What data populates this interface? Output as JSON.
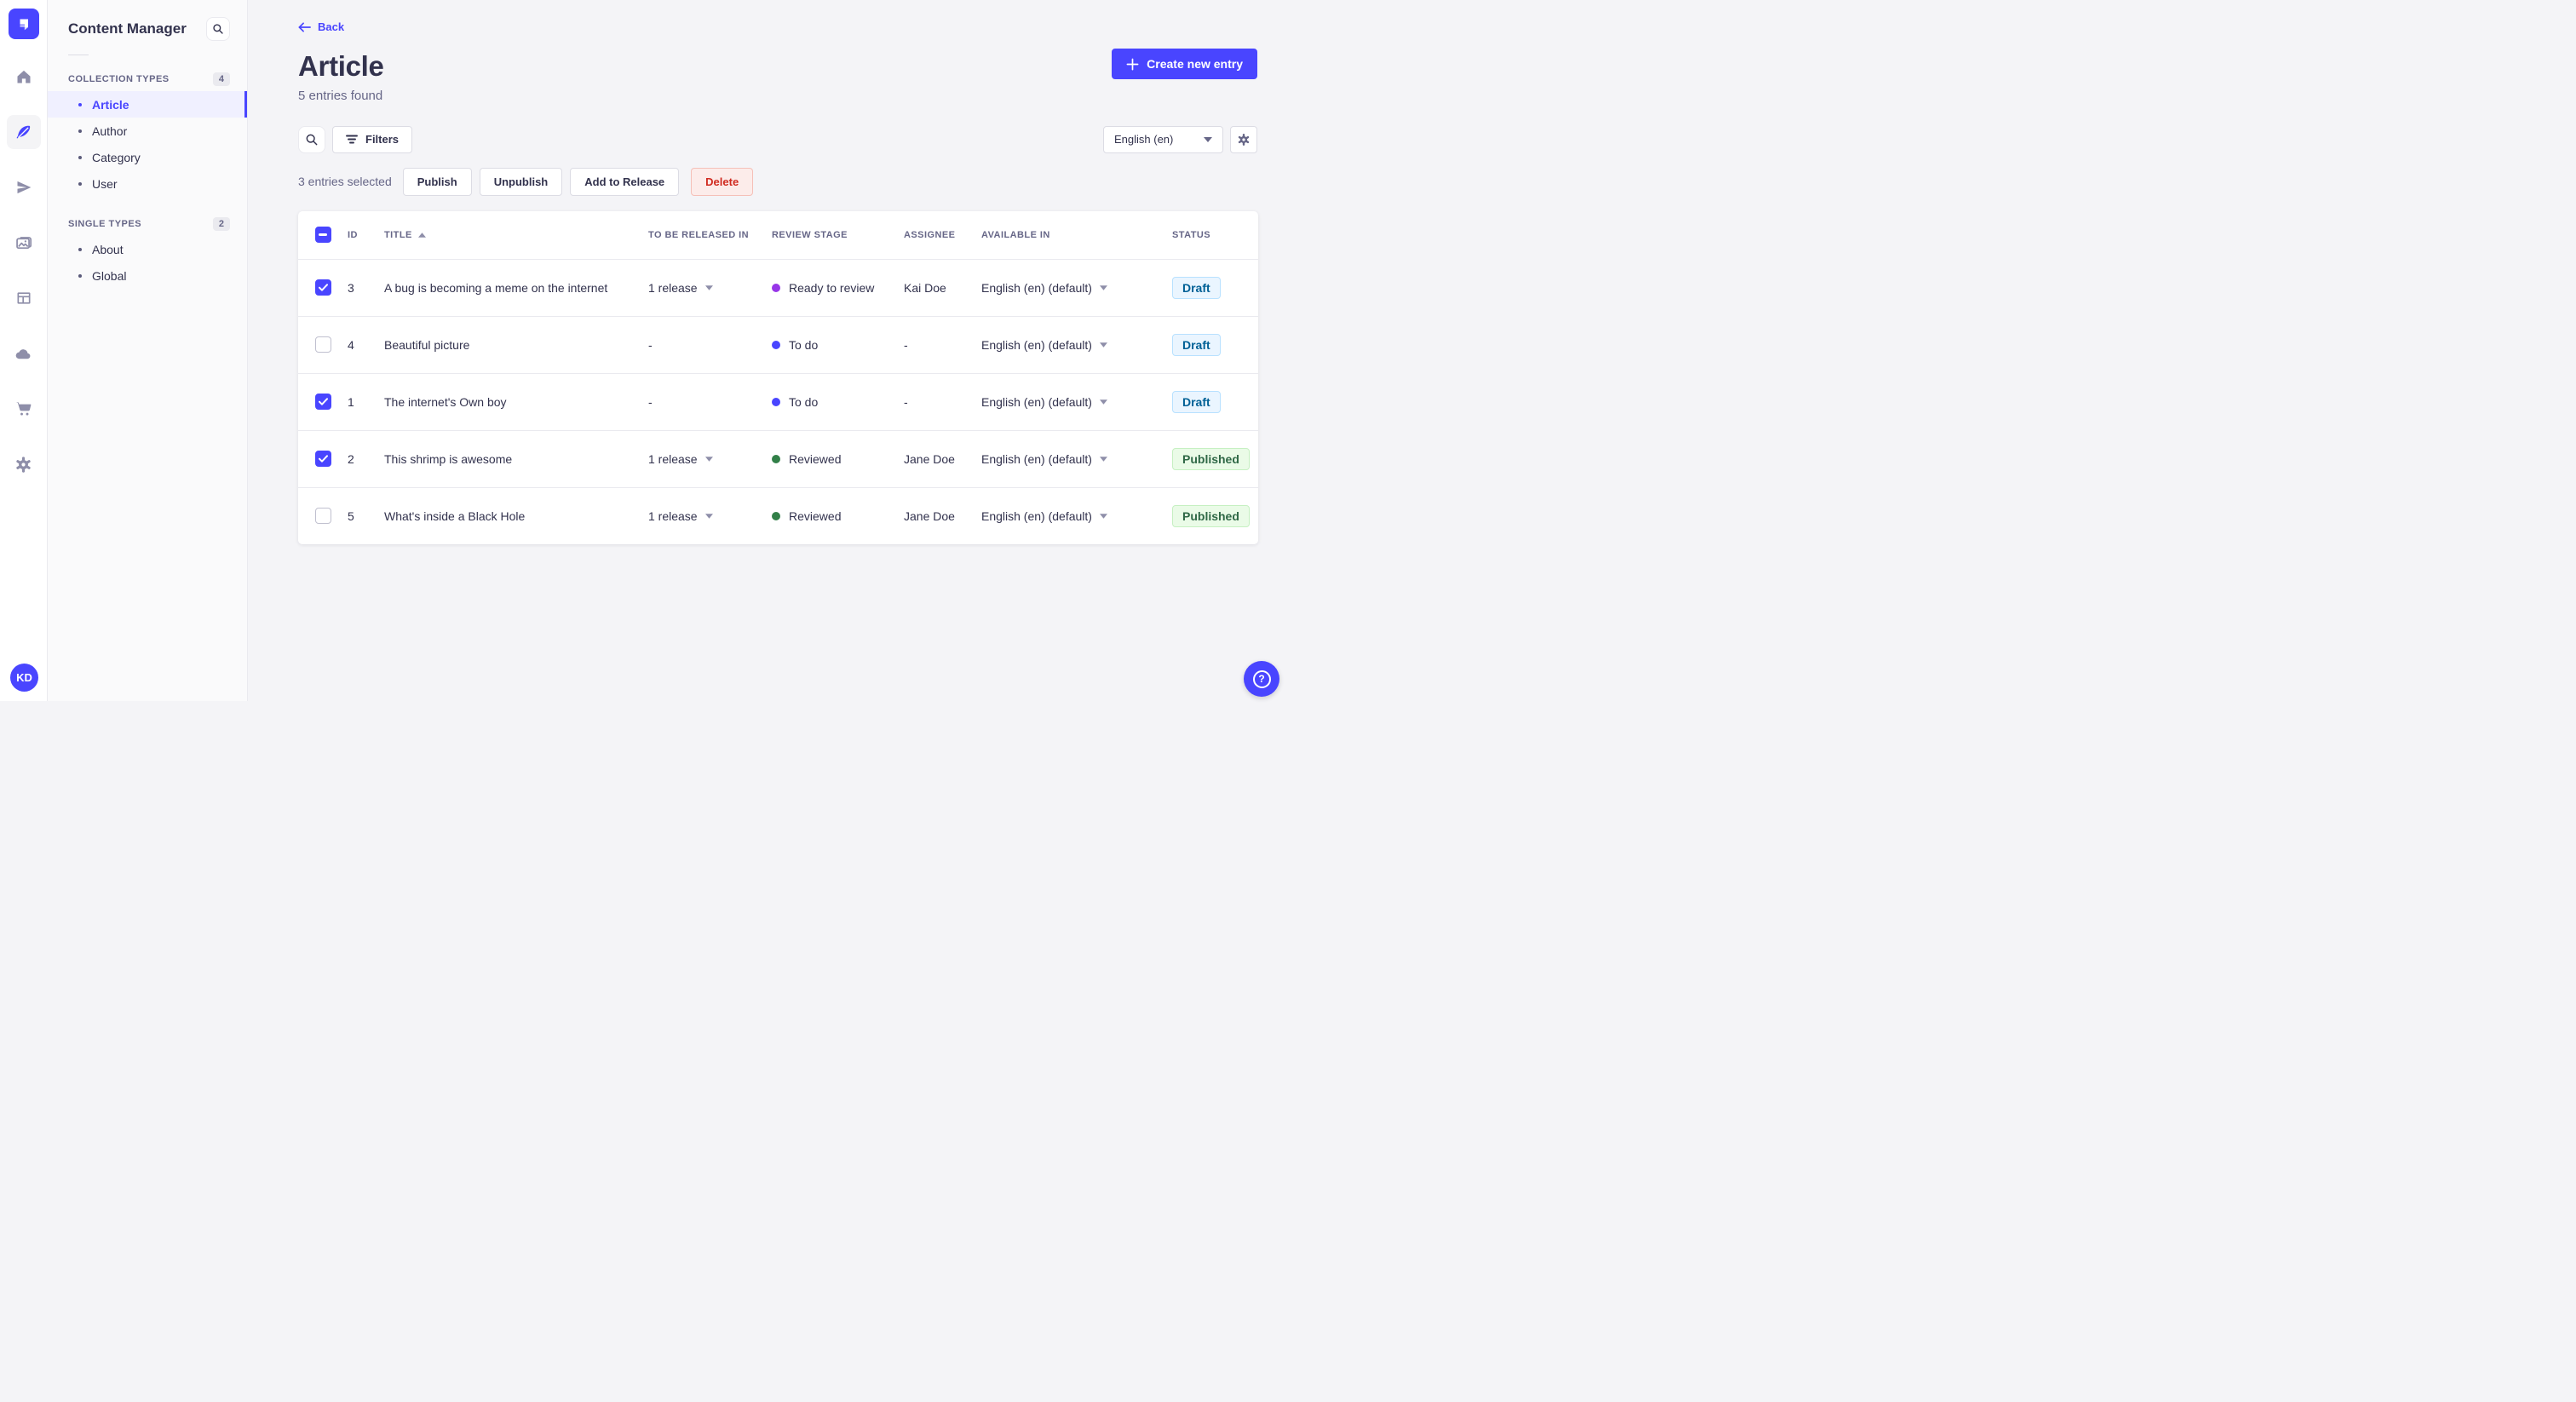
{
  "colors": {
    "accent": "#4945ff",
    "accent_light": "#f0f0ff",
    "draft_text": "#006096",
    "draft_bg": "#eaf5ff",
    "published_text": "#2f6846",
    "published_bg": "#eafbe7",
    "danger_text": "#d02b20",
    "danger_bg": "#fcecea",
    "stage_ready": "#9736e8",
    "stage_todo": "#4945ff",
    "stage_reviewed": "#328048"
  },
  "rail": {
    "logo_icon": "strapi-logo",
    "icons": [
      "home-icon",
      "feather-icon",
      "paper-plane-icon",
      "images-icon",
      "layout-icon",
      "cloud-icon",
      "cart-icon",
      "gear-icon"
    ],
    "active_icon": "feather-icon",
    "avatar_initials": "KD"
  },
  "subnav": {
    "title": "Content Manager",
    "search_icon": "search-icon",
    "sections": [
      {
        "label": "COLLECTION TYPES",
        "count": "4",
        "items": [
          {
            "label": "Article",
            "active": true
          },
          {
            "label": "Author"
          },
          {
            "label": "Category"
          },
          {
            "label": "User"
          }
        ]
      },
      {
        "label": "SINGLE TYPES",
        "count": "2",
        "items": [
          {
            "label": "About"
          },
          {
            "label": "Global"
          }
        ]
      }
    ]
  },
  "header": {
    "back_label": "Back",
    "title": "Article",
    "subtitle": "5 entries found",
    "create_label": "Create new entry"
  },
  "toolbar": {
    "search_icon": "search-icon",
    "filters_label": "Filters",
    "locale_value": "English (en)",
    "settings_icon": "gear-icon"
  },
  "selection": {
    "summary": "3 entries selected",
    "actions": {
      "publish": "Publish",
      "unpublish": "Unpublish",
      "add_to_release": "Add to Release",
      "delete": "Delete"
    }
  },
  "table": {
    "header_checkbox_state": "indeterminate",
    "columns": {
      "id": "ID",
      "title": "TITLE",
      "release": "TO BE RELEASED IN",
      "review_stage": "REVIEW STAGE",
      "assignee": "ASSIGNEE",
      "available_in": "AVAILABLE IN",
      "status": "STATUS"
    },
    "sorted_by": {
      "column": "TITLE",
      "direction": "ascending"
    },
    "rows": [
      {
        "selected": true,
        "id": "3",
        "title": "A bug is becoming a meme on the internet",
        "release": "1 release",
        "release_caret": true,
        "stage": "Ready to review",
        "stage_color": "#9736e8",
        "assignee": "Kai Doe",
        "available": "English (en) (default)",
        "available_caret": true,
        "status": "Draft"
      },
      {
        "selected": false,
        "id": "4",
        "title": "Beautiful picture",
        "release": "-",
        "release_caret": false,
        "stage": "To do",
        "stage_color": "#4945ff",
        "assignee": "-",
        "available": "English (en) (default)",
        "available_caret": true,
        "status": "Draft"
      },
      {
        "selected": true,
        "id": "1",
        "title": "The internet's Own boy",
        "release": "-",
        "release_caret": false,
        "stage": "To do",
        "stage_color": "#4945ff",
        "assignee": "-",
        "available": "English (en) (default)",
        "available_caret": true,
        "status": "Draft"
      },
      {
        "selected": true,
        "id": "2",
        "title": "This shrimp is awesome",
        "release": "1 release",
        "release_caret": true,
        "stage": "Reviewed",
        "stage_color": "#328048",
        "assignee": "Jane Doe",
        "available": "English (en) (default)",
        "available_caret": true,
        "status": "Published"
      },
      {
        "selected": false,
        "id": "5",
        "title": "What's inside a Black Hole",
        "release": "1 release",
        "release_caret": true,
        "stage": "Reviewed",
        "stage_color": "#328048",
        "assignee": "Jane Doe",
        "available": "English (en) (default)",
        "available_caret": true,
        "status": "Published"
      }
    ]
  },
  "fab": {
    "icon": "question-mark-icon",
    "glyph": "?"
  }
}
